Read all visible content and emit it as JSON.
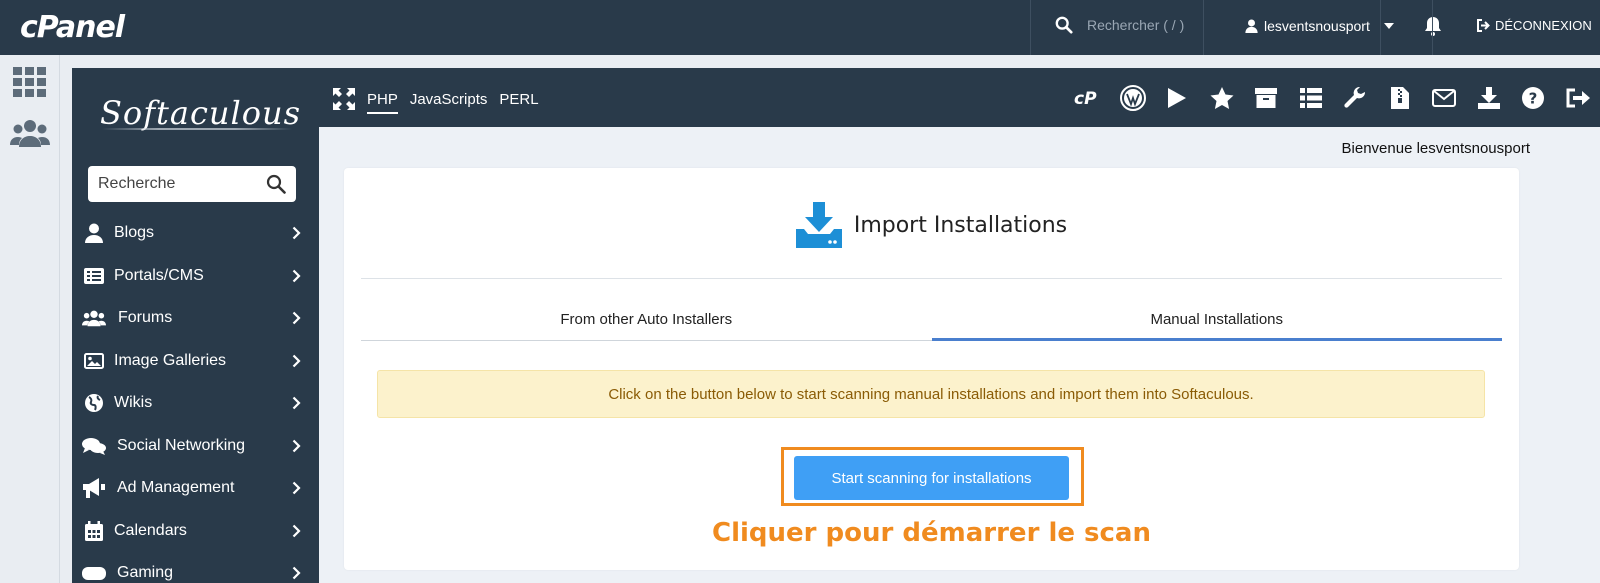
{
  "cpanel": {
    "logo": "cPanel",
    "search_placeholder": "Rechercher ( / )",
    "username": "lesventsnousport",
    "logout_label": "DÉCONNEXION"
  },
  "softaculous": {
    "logo": "Softaculous",
    "search_placeholder": "Recherche",
    "lang_tabs": [
      "PHP",
      "JavaScripts",
      "PERL"
    ],
    "active_lang": "PHP",
    "nav": [
      {
        "label": "Blogs",
        "icon": "user-icon"
      },
      {
        "label": "Portals/CMS",
        "icon": "list-icon"
      },
      {
        "label": "Forums",
        "icon": "users-icon"
      },
      {
        "label": "Image Galleries",
        "icon": "image-icon"
      },
      {
        "label": "Wikis",
        "icon": "globe-icon"
      },
      {
        "label": "Social Networking",
        "icon": "comments-icon"
      },
      {
        "label": "Ad Management",
        "icon": "bullhorn-icon"
      },
      {
        "label": "Calendars",
        "icon": "calendar-icon"
      },
      {
        "label": "Gaming",
        "icon": "gamepad-icon"
      }
    ],
    "toolbar_icons": [
      "cpanel-icon",
      "wordpress-icon",
      "play-icon",
      "star-icon",
      "archive-icon",
      "list-icon",
      "wrench-icon",
      "file-zip-icon",
      "mail-icon",
      "download-icon",
      "help-icon",
      "logout-icon"
    ],
    "welcome": "Bienvenue lesventsnousport",
    "page_title": "Import Installations",
    "tabs": [
      "From other Auto Installers",
      "Manual Installations"
    ],
    "active_tab": "Manual Installations",
    "notice": "Click on the button below to start scanning manual installations and import them into Softaculous.",
    "scan_button": "Start scanning for installations",
    "annotation": "Cliquer pour démarrer le scan"
  },
  "colors": {
    "navy": "#293a4a",
    "accent_blue": "#3f9ff5",
    "highlight_orange": "#f08b1f",
    "notice_bg": "#fcf2cc"
  }
}
